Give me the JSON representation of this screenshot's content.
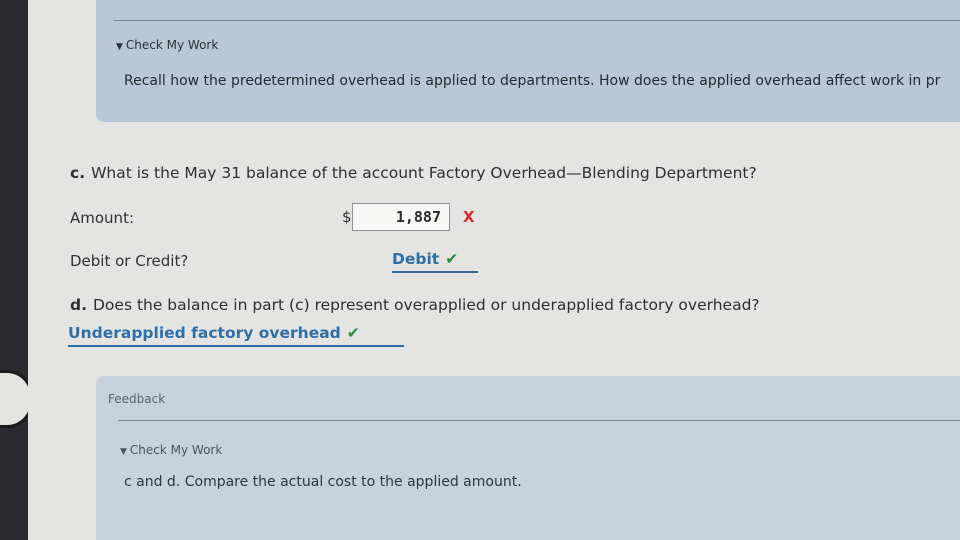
{
  "top_feedback": {
    "check_my_work": "Check My Work",
    "hint": "Recall how the predetermined overhead is applied to departments. How does the applied overhead affect work in pr"
  },
  "part_c": {
    "letter": "c.",
    "question": "What is the May 31 balance of the account Factory Overhead—Blending Department?",
    "amount_label": "Amount:",
    "currency": "$",
    "amount_value": "1,887",
    "amount_status": "X",
    "debit_credit_label": "Debit or Credit?",
    "debit_credit_value": "Debit",
    "debit_credit_status": "✔"
  },
  "part_d": {
    "letter": "d.",
    "question": "Does the balance in part (c) represent overapplied or underapplied factory overhead?",
    "answer": "Underapplied factory overhead",
    "answer_status": "✔"
  },
  "bottom_feedback": {
    "title": "Feedback",
    "check_my_work": "Check My Work",
    "hint": "c and d. Compare the actual cost to the applied amount."
  },
  "colors": {
    "link_blue": "#2e6fa8",
    "correct_green": "#2f8a3a",
    "wrong_red": "#d42a2a",
    "feedback_bg": "#b9c8d6"
  }
}
